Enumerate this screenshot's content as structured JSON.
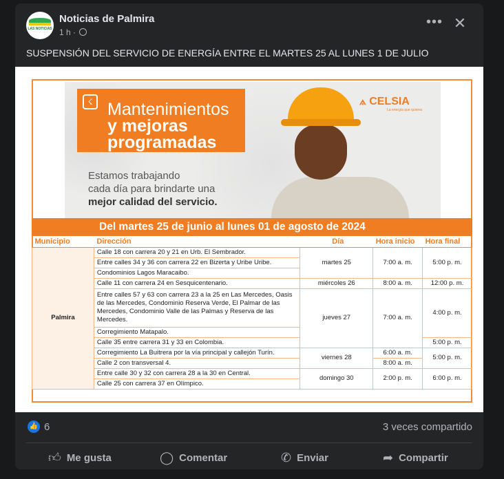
{
  "post": {
    "page_name": "Noticias de Palmira",
    "avatar_text": "LAS NOTICIAS",
    "time": "1 h",
    "text": "SUSPENSIÓN DEL SERVICIO DE ENERGÍA ENTRE EL MARTES 25 AL LUNES 1 DE JULIO",
    "more_icon": "•••",
    "close_icon": "✕"
  },
  "image": {
    "title_line1": "Mantenimientos",
    "title_line2": "y mejoras",
    "title_line3": "programadas",
    "sub_line1": "Estamos trabajando",
    "sub_line2": "cada día para brindarte una",
    "sub_line3": "mejor calidad del servicio.",
    "brand": "CELSIA",
    "brand_tagline": "La energía que quieres",
    "date_range": "Del martes 25 de junio al lunes 01 de agosto de 2024",
    "columns": [
      "Municipio",
      "Dirección",
      "Día",
      "Hora inicio",
      "Hora final"
    ],
    "municipio": "Palmira",
    "rows": [
      {
        "dir": "Calle 18 con carrera 20 y 21 en Urb. El Sembrador.",
        "dia": "",
        "inicio": "",
        "final": ""
      },
      {
        "dir": "Entre calles 34 y 36 con carrera 22 en Bizerta y Uribe Uribe.",
        "dia": "martes 25",
        "inicio": "7:00 a. m.",
        "final": "5:00 p. m."
      },
      {
        "dir": "Condominios Lagos Maracaibo.",
        "dia": "",
        "inicio": "",
        "final": ""
      },
      {
        "dir": "Calle 11 con carrera 24 en Sesquicentenario.",
        "dia": "miércoles 26",
        "inicio": "8:00 a. m.",
        "final": "12:00 p. m."
      },
      {
        "dir": "Entre calles 57 y 63 con carrera 23 a la 25 en Las Mercedes, Oasis de las Mercedes, Condominio Reserva Verde, El Palmar de las Mercedes, Condominio Valle de las Palmas y Reserva de las Mercedes.",
        "dia": "jueves 27",
        "inicio": "7:00 a. m.",
        "final": "4:00 p. m."
      },
      {
        "dir": "Corregimiento Matapalo.",
        "dia": "",
        "inicio": "",
        "final": ""
      },
      {
        "dir": "Calle 35 entre carrera 31 y 33 en Colombia.",
        "dia": "",
        "inicio": "",
        "final": "5:00 p. m."
      },
      {
        "dir": "Corregimiento La Buitrera por la vía principal y callejón Turín.",
        "dia": "viernes 28",
        "inicio": "6:00 a. m.",
        "final": "5:00 p. m."
      },
      {
        "dir": "Calle 2 con transversal 4.",
        "dia": "",
        "inicio": "8:00 a. m.",
        "final": ""
      },
      {
        "dir": "Entre calle 30 y 32 con carrera 28 a la 30 en Central.",
        "dia": "domingo 30",
        "inicio": "2:00 p. m.",
        "final": "6:00 p. m."
      },
      {
        "dir": "Calle 25 con carrera 37 en Olímpico.",
        "dia": "",
        "inicio": "",
        "final": ""
      }
    ]
  },
  "footer": {
    "like_icon": "👍",
    "likes": "6",
    "shares": "3 veces compartido",
    "like_label": "Me gusta",
    "comment_label": "Comentar",
    "send_label": "Enviar",
    "share_label": "Compartir"
  },
  "colors": {
    "accent": "#f07d22",
    "fb_blue": "#1b74e4",
    "card": "#242526"
  }
}
